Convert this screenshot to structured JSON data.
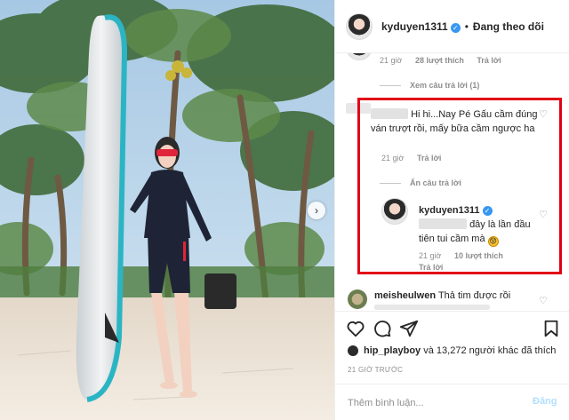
{
  "post": {
    "username": "kyduyen1311",
    "follow_state": "Đang theo dõi",
    "separator": "•"
  },
  "comment1": {
    "time": "21 giờ",
    "likes": "28 lượt thích",
    "reply": "Trả lời",
    "view_replies": "Xem câu trả lời (1)"
  },
  "comment2": {
    "text": "Hi hi...Nay Pé Gấu cầm đúng ván trượt rồi, mấy bữa cầm ngược ha",
    "time": "21 giờ",
    "reply": "Trả lời",
    "hide_replies": "Ẩn câu trả lời"
  },
  "reply1": {
    "username": "kyduyen1311",
    "text": "đây là lần đầu tiên tui cầm mà",
    "emoji": "😟",
    "time": "21 giờ",
    "likes": "10 lượt thích",
    "reply": "Trả lời"
  },
  "comment3": {
    "username": "meisheulwen",
    "text": "Thả tim được rồi"
  },
  "likes_summary": {
    "user": "hip_playboy",
    "rest": "và 13,272 người khác đã thích"
  },
  "timestamp": "21 GIỜ TRƯỚC",
  "composer": {
    "placeholder": "Thêm bình luận...",
    "post": "Đăng"
  },
  "icons": {
    "like": "heart-icon",
    "comment": "comment-icon",
    "share": "share-icon",
    "save": "bookmark-icon",
    "next": "chevron-right-icon",
    "verified": "verified-badge-icon"
  },
  "colors": {
    "highlight": "#e10016",
    "verified": "#3897f0",
    "post_button_disabled": "#b2dffc",
    "muted_text": "#8e8e8e"
  }
}
